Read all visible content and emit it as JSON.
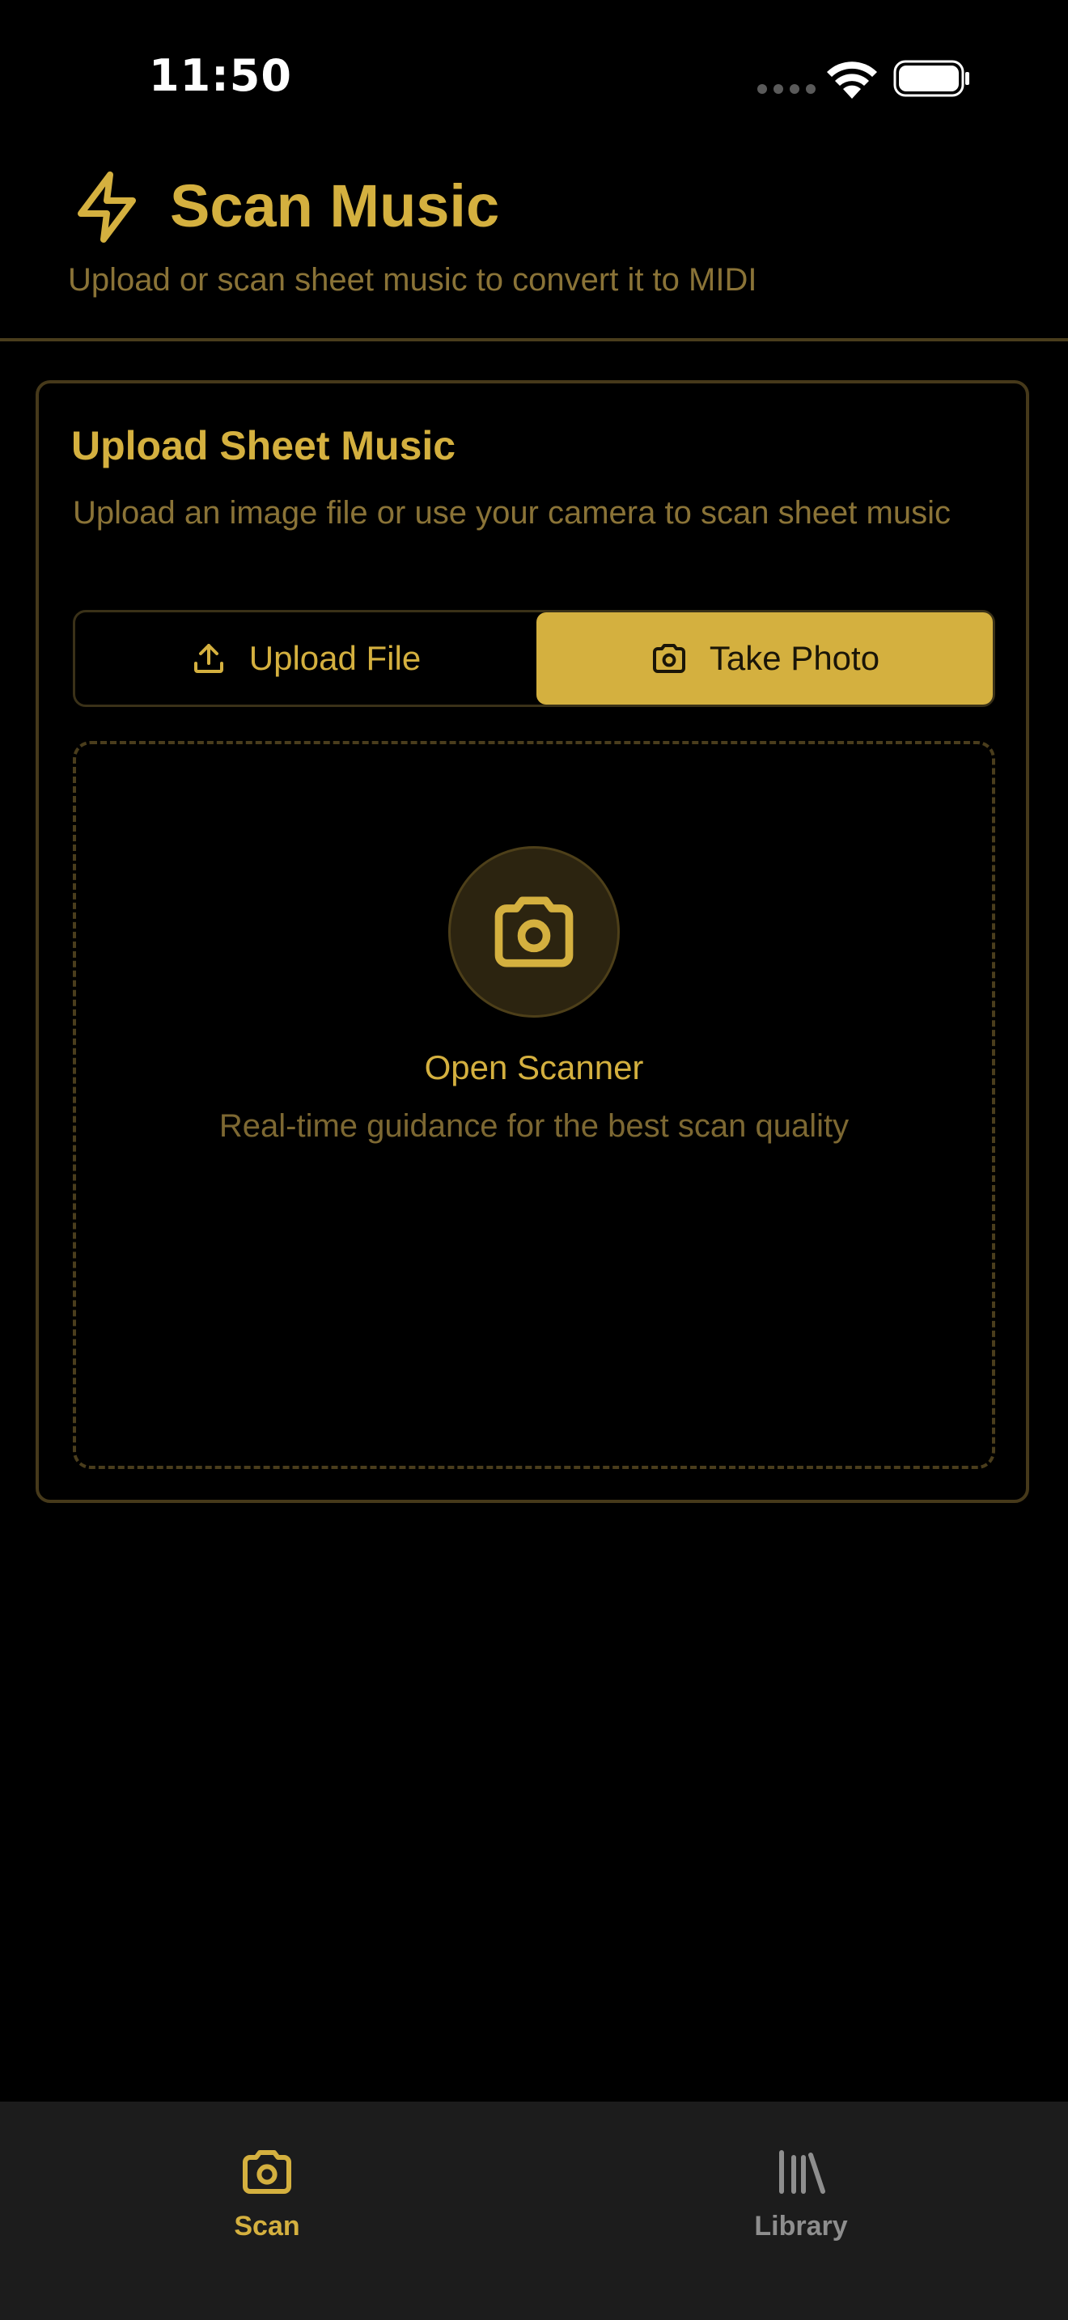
{
  "status_bar": {
    "time": "11:50"
  },
  "header": {
    "title": "Scan Music",
    "subtitle": "Upload or scan sheet music to convert it to MIDI",
    "icon": "lightning-icon"
  },
  "card": {
    "title": "Upload Sheet Music",
    "description": "Upload an image file or use your camera to scan sheet music",
    "segments": [
      {
        "label": "Upload File",
        "icon": "upload-icon",
        "selected": false
      },
      {
        "label": "Take Photo",
        "icon": "camera-icon",
        "selected": true
      }
    ],
    "scanner": {
      "title": "Open Scanner",
      "hint": "Real-time guidance for the best scan quality",
      "icon": "camera-icon"
    }
  },
  "tab_bar": {
    "tabs": [
      {
        "label": "Scan",
        "icon": "camera-icon",
        "active": true
      },
      {
        "label": "Library",
        "icon": "library-icon",
        "active": false
      }
    ]
  },
  "colors": {
    "accent": "#d4b03f",
    "muted_accent": "#8a7337",
    "background": "#000000",
    "tab_bar": "#1c1c1c"
  }
}
